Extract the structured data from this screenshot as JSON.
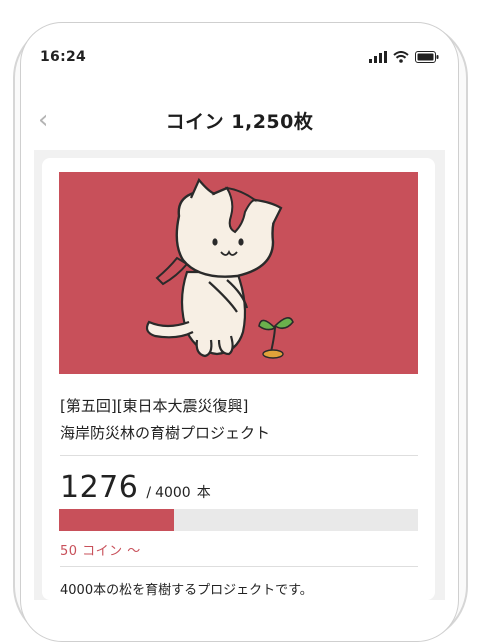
{
  "status_bar": {
    "time": "16:24"
  },
  "nav": {
    "back_icon": "chevron-left-icon",
    "title": "コイン 1,250枚"
  },
  "project": {
    "title_line1": "[第五回][東日本大震災復興]",
    "title_line2": "海岸防災林の育樹プロジェクト",
    "current": "1276",
    "separator": "/",
    "total": "4000",
    "unit": "本",
    "progress_fraction": 0.319,
    "coin_link": "50 コイン ～",
    "description": "4000本の松を育樹するプロジェクトです。"
  },
  "colors": {
    "accent": "#c8505a",
    "progress_track": "#e9e9e9"
  }
}
